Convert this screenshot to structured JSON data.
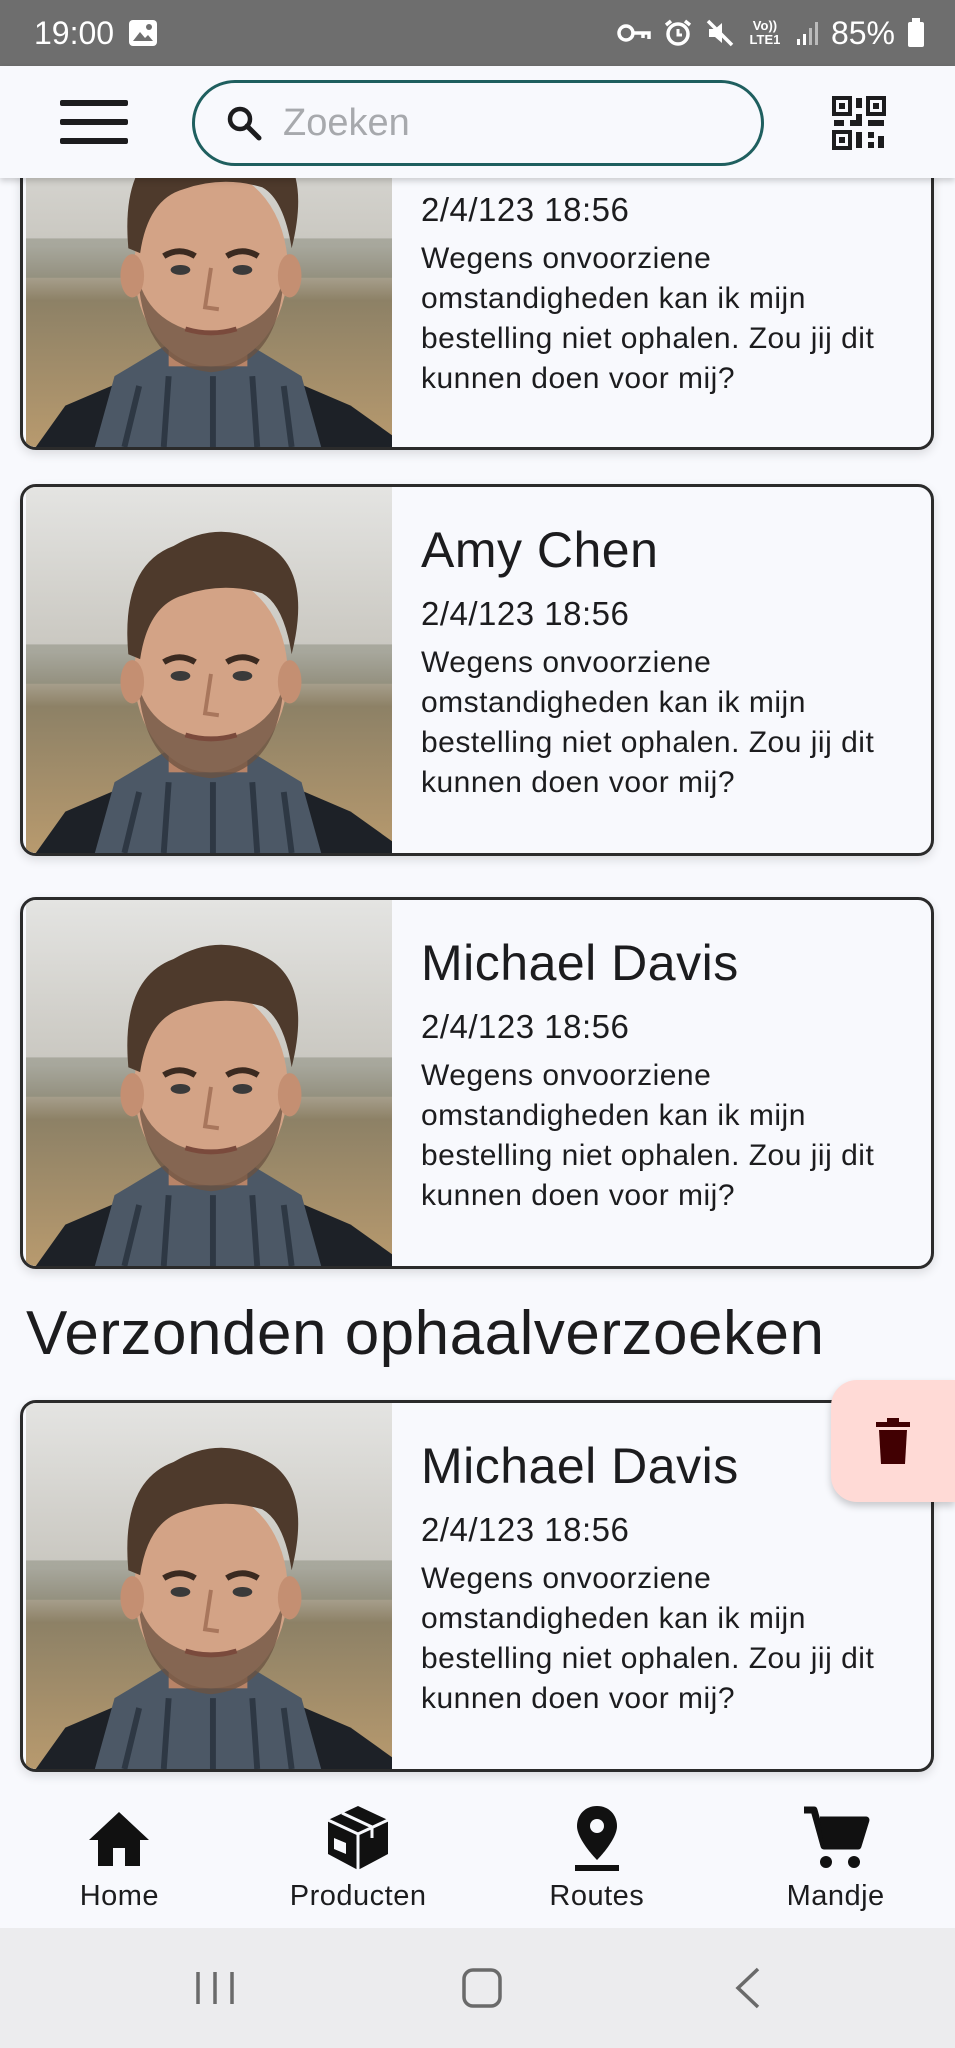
{
  "status_bar": {
    "time": "19:00",
    "network": "Vo)) LTE1",
    "battery": "85%",
    "icons": [
      "gallery-icon",
      "key-icon",
      "alarm-icon",
      "mute-icon",
      "signal-icon",
      "battery-icon"
    ]
  },
  "app_bar": {
    "search_placeholder": "Zoeken",
    "accent_color": "#1f5f5f"
  },
  "cards": [
    {
      "name": "",
      "date": "2/4/123 18:56",
      "message": "Wegens onvoorziene omstandigheden kan ik mijn bestelling niet ophalen. Zou jij dit kunnen doen voor mij?"
    },
    {
      "name": "Amy Chen",
      "date": "2/4/123 18:56",
      "message": "Wegens onvoorziene omstandigheden kan ik mijn bestelling niet ophalen. Zou jij dit kunnen doen voor mij?"
    },
    {
      "name": "Michael Davis",
      "date": "2/4/123 18:56",
      "message": "Wegens onvoorziene omstandigheden kan ik mijn bestelling niet ophalen. Zou jij dit kunnen doen voor mij?"
    }
  ],
  "sent_section": {
    "title": "Verzonden ophaalverzoeken",
    "cards": [
      {
        "name": "Michael Davis",
        "date": "2/4/123 18:56",
        "message": "Wegens onvoorziene omstandigheden kan ik mijn bestelling niet ophalen. Zou jij dit kunnen doen voor mij?"
      }
    ]
  },
  "fab": {
    "icon": "trash-icon",
    "background": "#ffdad6",
    "icon_color": "#410002"
  },
  "bottom_nav": {
    "items": [
      {
        "label": "Home",
        "icon": "home-icon"
      },
      {
        "label": "Producten",
        "icon": "package-icon"
      },
      {
        "label": "Routes",
        "icon": "location-pin-icon"
      },
      {
        "label": "Mandje",
        "icon": "cart-icon"
      }
    ]
  },
  "system_nav": {
    "buttons": [
      "recents-icon",
      "home-outline-icon",
      "back-icon"
    ]
  }
}
